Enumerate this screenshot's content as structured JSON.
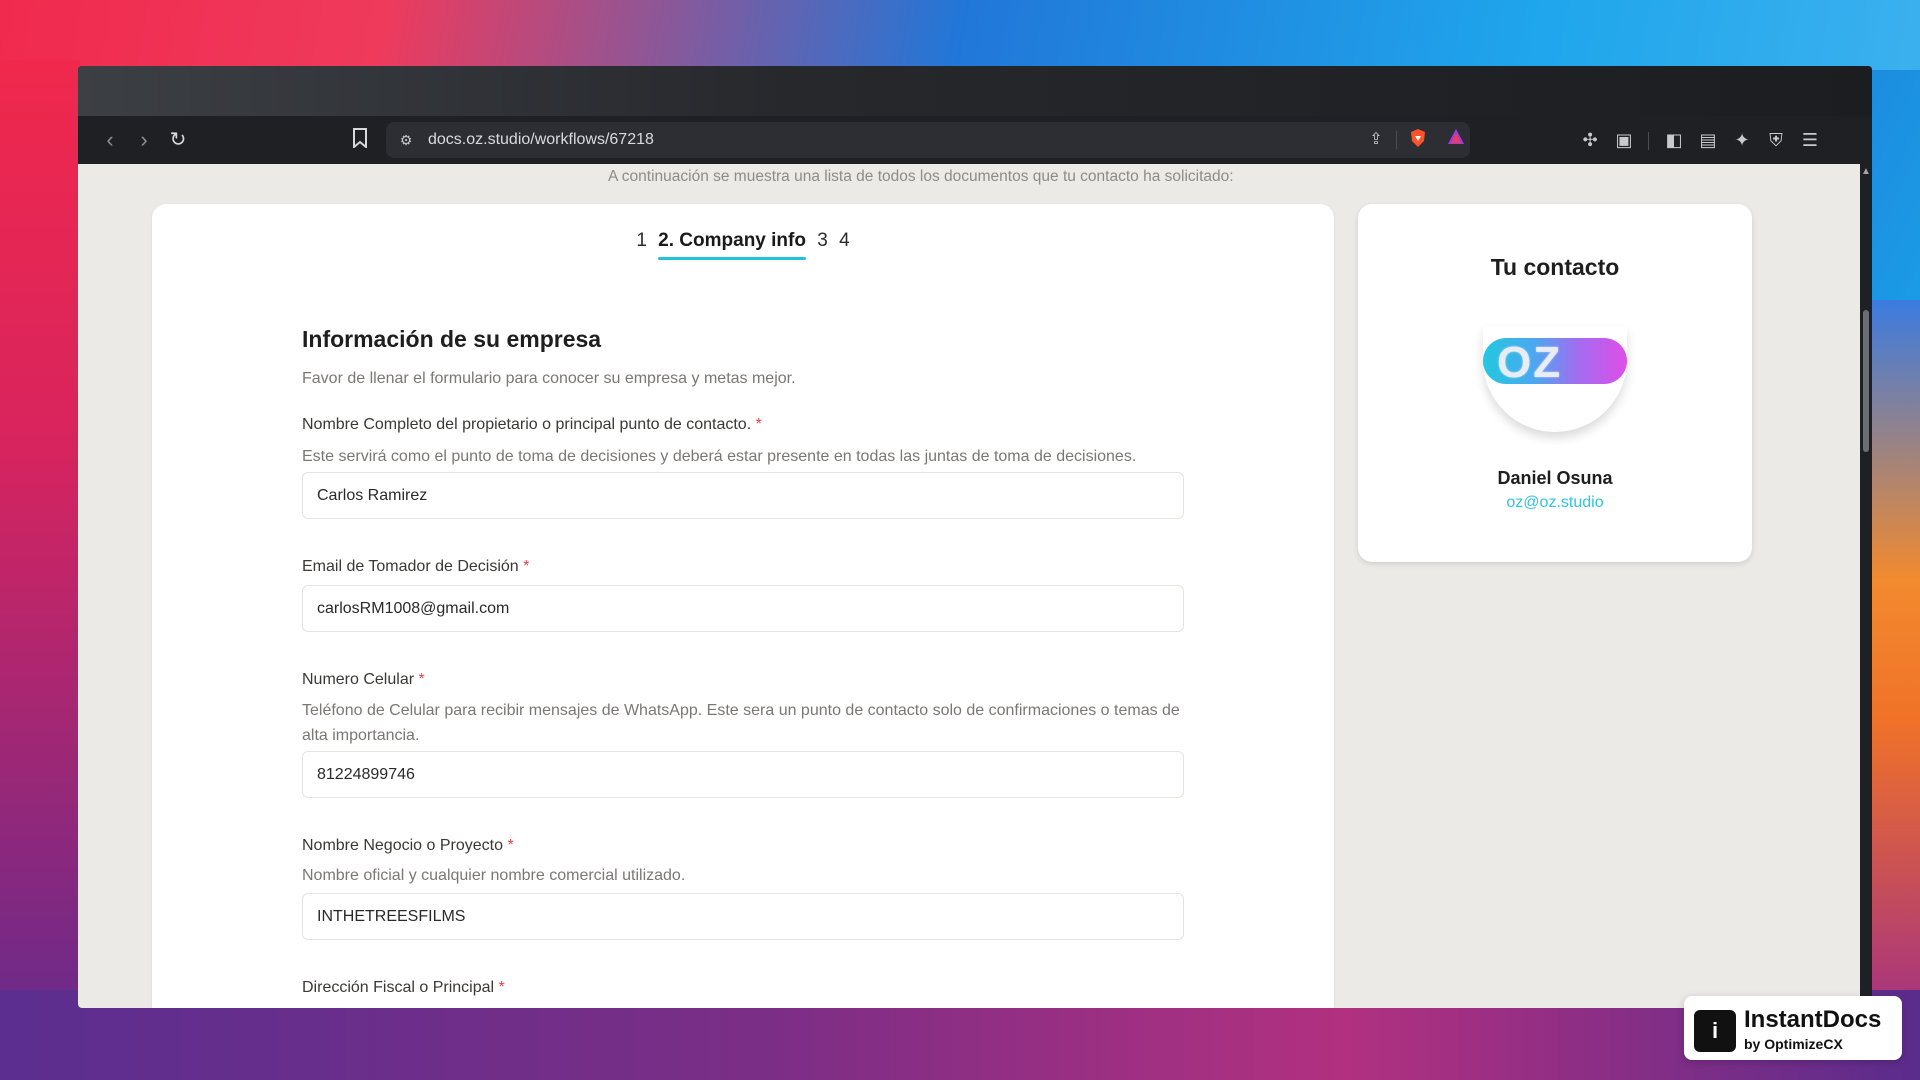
{
  "browser": {
    "url": "docs.oz.studio/workflows/67218"
  },
  "page": {
    "intro": "A continuación se muestra una lista de todos los documentos que tu contacto ha solicitado:",
    "steps": [
      "1",
      "2. Company info",
      "3",
      "4"
    ],
    "section_title": "Información de su empresa",
    "section_subtitle": "Favor de llenar el formulario para conocer su empresa y metas mejor.",
    "fields": [
      {
        "label": "Nombre Completo del propietario o principal punto de contacto.",
        "required": "*",
        "help": "Este servirá como el punto de toma de decisiones y deberá estar presente en todas las juntas de toma de decisiones.",
        "value": "Carlos Ramirez"
      },
      {
        "label": "Email de Tomador de Decisión",
        "required": "*",
        "help": "",
        "value": "carlosRM1008@gmail.com"
      },
      {
        "label": "Numero Celular",
        "required": "*",
        "help": "Teléfono de Celular para recibir mensajes de WhatsApp. Este sera un punto de contacto solo de confirmaciones o temas de alta importancia.",
        "value": "81224899746"
      },
      {
        "label": "Nombre Negocio o Proyecto",
        "required": "*",
        "help": "Nombre oficial y cualquier nombre comercial utilizado.",
        "value": "INTHETREESFILMS"
      },
      {
        "label": "Dirección Fiscal o Principal",
        "required": "*",
        "help": "",
        "value": ""
      }
    ]
  },
  "contact": {
    "title": "Tu contacto",
    "logo_text": "OZ",
    "name": "Daniel Osuna",
    "email": "oz@oz.studio"
  },
  "badge": {
    "name": "InstantDocs",
    "by": "by OptimizeCX"
  },
  "colors": {
    "accent": "#22c2dc",
    "required": "#e0434e",
    "page_bg": "#eceae6"
  }
}
